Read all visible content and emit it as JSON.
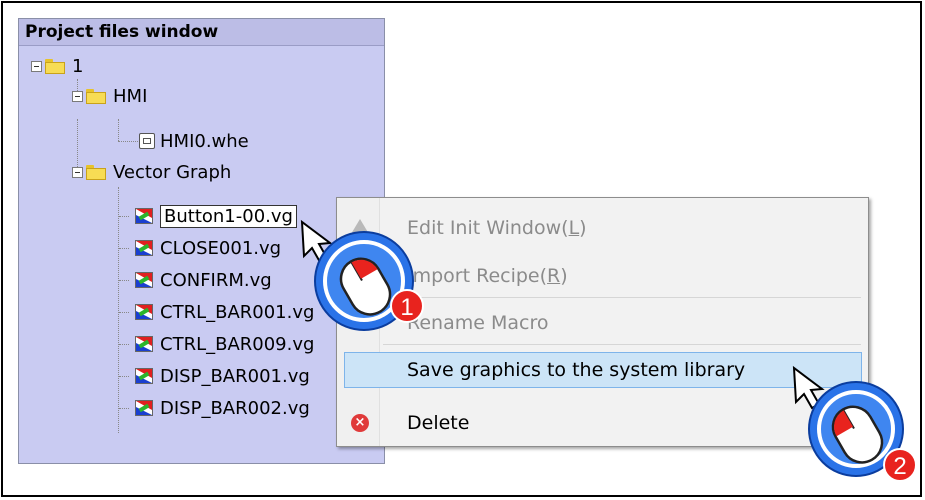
{
  "panel": {
    "title": "Project files window",
    "tree": [
      {
        "label": "1",
        "type": "folder",
        "icon": "folder-icon"
      },
      {
        "label": "HMI",
        "type": "folder",
        "icon": "folder-icon"
      },
      {
        "label": "HMI0.whe",
        "type": "file",
        "icon": "hmi-file-icon"
      },
      {
        "label": "Vector Graph",
        "type": "folder",
        "icon": "folder-icon"
      },
      {
        "label": "Button1-00.vg",
        "type": "vg",
        "icon": "vector-graph-icon",
        "selected": true
      },
      {
        "label": "CLOSE001.vg",
        "type": "vg",
        "icon": "vector-graph-icon"
      },
      {
        "label": "CONFIRM.vg",
        "type": "vg",
        "icon": "vector-graph-icon"
      },
      {
        "label": "CTRL_BAR001.vg",
        "type": "vg",
        "icon": "vector-graph-icon"
      },
      {
        "label": "CTRL_BAR009.vg",
        "type": "vg",
        "icon": "vector-graph-icon"
      },
      {
        "label": "DISP_BAR001.vg",
        "type": "vg",
        "icon": "vector-graph-icon"
      },
      {
        "label": "DISP_BAR002.vg",
        "type": "vg",
        "icon": "vector-graph-icon"
      }
    ]
  },
  "context_menu": {
    "items": [
      {
        "label_pre": "Edit Init Window(",
        "mnemonic": "L",
        "label_post": ")",
        "disabled": true,
        "icon": "edit-init-window-icon"
      },
      {
        "label_pre": "Import Recipe(",
        "mnemonic": "R",
        "label_post": ")",
        "disabled": true,
        "icon": ""
      },
      {
        "label": "Rename Macro",
        "disabled": true,
        "icon": ""
      },
      {
        "label": "Save graphics to the system library",
        "disabled": false,
        "hover": true,
        "icon": ""
      },
      {
        "label": "Delete",
        "disabled": false,
        "icon": "delete-icon"
      }
    ]
  },
  "annotations": [
    {
      "label": "1",
      "action": "right-click"
    },
    {
      "label": "2",
      "action": "left-click"
    }
  ],
  "colors": {
    "panel_bg": "#c9cbf2",
    "menu_hover": "#cce4f7",
    "badge": "#e8231e",
    "cursor_ring": "#2a73e8"
  }
}
